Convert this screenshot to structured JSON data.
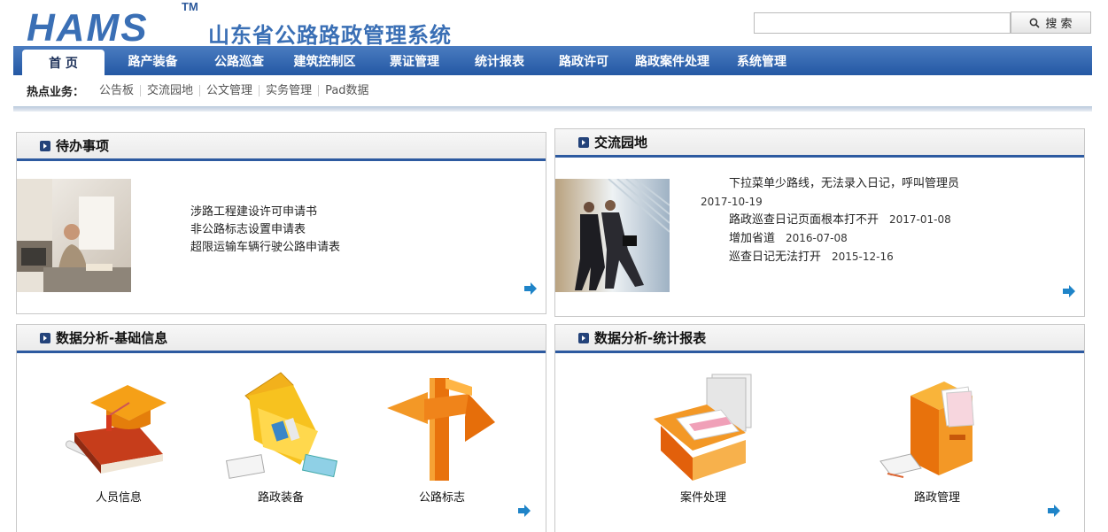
{
  "header": {
    "logo_text": "HAMS",
    "trademark": "TM",
    "system_title": "山东省公路路政管理系统",
    "search_value": "",
    "search_button": "搜 索"
  },
  "nav": {
    "items": [
      "首 页",
      "路产装备",
      "公路巡查",
      "建筑控制区",
      "票证管理",
      "统计报表",
      "路政许可",
      "路政案件处理",
      "系统管理"
    ],
    "active_index": 0
  },
  "hotbar": {
    "label": "热点业务：",
    "links": [
      "公告板",
      "交流园地",
      "公文管理",
      "实务管理",
      "Pad数据"
    ]
  },
  "todo": {
    "title": "待办事项",
    "items": [
      "涉路工程建设许可申请书",
      "非公路标志设置申请表",
      "超限运输车辆行驶公路申请表"
    ]
  },
  "forum": {
    "title": "交流园地",
    "items": [
      {
        "text": "下拉菜单少路线，无法录入日记，呼叫管理员",
        "date": "2017-10-19"
      },
      {
        "text": "路政巡查日记页面根本打不开",
        "date": "2017-01-08"
      },
      {
        "text": "增加省道",
        "date": "2016-07-08"
      },
      {
        "text": "巡查日记无法打开",
        "date": "2015-12-16"
      }
    ]
  },
  "basic_info": {
    "title": "数据分析-基础信息",
    "items": [
      {
        "label": "人员信息",
        "icon": "graduation-book-icon"
      },
      {
        "label": "路政装备",
        "icon": "toolbox-icon"
      },
      {
        "label": "公路标志",
        "icon": "signpost-icon"
      }
    ]
  },
  "stat_report": {
    "title": "数据分析-统计报表",
    "items": [
      {
        "label": "案件处理",
        "icon": "document-tray-icon"
      },
      {
        "label": "路政管理",
        "icon": "file-cabinet-icon"
      }
    ]
  },
  "colors": {
    "brand_blue": "#2d5aa0",
    "nav_blue": "#2458a4",
    "icon_orange": "#f08a1e"
  }
}
